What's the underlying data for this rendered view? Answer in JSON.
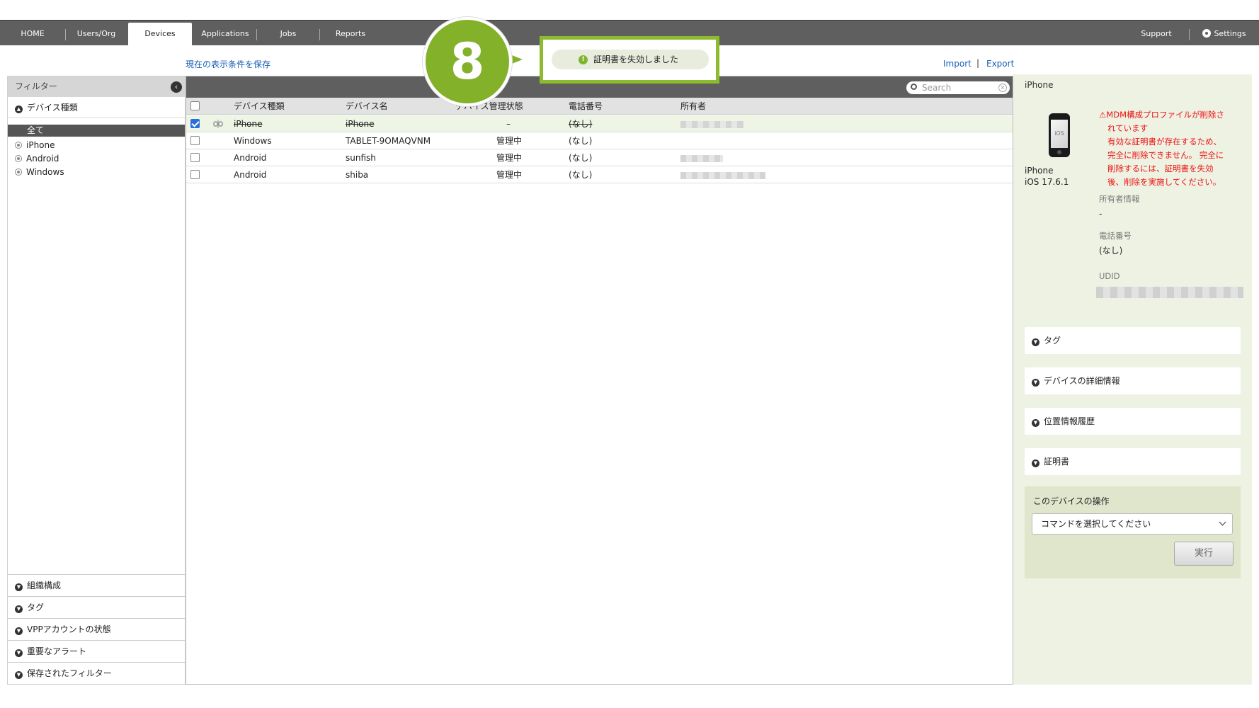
{
  "nav": {
    "tabs": [
      {
        "label": "HOME"
      },
      {
        "label": "Users/Org"
      },
      {
        "label": "Devices"
      },
      {
        "label": "Applications"
      },
      {
        "label": "Jobs"
      },
      {
        "label": "Reports"
      }
    ],
    "support": "Support",
    "settings": "Settings"
  },
  "toolbar": {
    "save_view": "現在の表示条件を保存",
    "import": "Import",
    "separator": "|",
    "export": "Export"
  },
  "toast": {
    "message": "証明書を失効しました",
    "callout_number": "8"
  },
  "filter": {
    "title": "フィルター",
    "device_type_header": "デバイス種類",
    "options": [
      "全て",
      "iPhone",
      "Android",
      "Windows"
    ],
    "selected": "全て",
    "sections": [
      "組織構成",
      "タグ",
      "VPPアカウントの状態",
      "重要なアラート",
      "保存されたフィルター"
    ]
  },
  "table": {
    "search_placeholder": "Search",
    "columns": [
      "デバイス種類",
      "デバイス名",
      "デバイス管理状態",
      "電話番号",
      "所有者"
    ],
    "rows": [
      {
        "type": "iPhone",
        "name": "iPhone",
        "status": "–",
        "phone": "(なし)",
        "checked": true,
        "struck": true
      },
      {
        "type": "Windows",
        "name": "TABLET-9OMAQVNM",
        "status": "管理中",
        "phone": "(なし)",
        "checked": false,
        "struck": false
      },
      {
        "type": "Android",
        "name": "sunfish",
        "status": "管理中",
        "phone": "(なし)",
        "checked": false,
        "struck": false
      },
      {
        "type": "Android",
        "name": "shiba",
        "status": "管理中",
        "phone": "(なし)",
        "checked": false,
        "struck": false
      }
    ]
  },
  "detail": {
    "title": "iPhone",
    "icon_text": "iOS",
    "model": "iPhone",
    "os": "iOS 17.6.1",
    "warning_lines": [
      "⚠MDM構成プロファイルが削除さ",
      "れています",
      "有効な証明書が存在するため、",
      "完全に削除できません。 完全に",
      "削除するには、証明書を失効",
      "後、削除を実施してください。"
    ],
    "owner_label": "所有者情報",
    "owner_value": "-",
    "phone_label": "電話番号",
    "phone_value": "(なし)",
    "udid_label": "UDID",
    "accordions": [
      "タグ",
      "デバイスの詳細情報",
      "位置情報履歴",
      "証明書"
    ],
    "ops_title": "このデバイスの操作",
    "command_placeholder": "コマンドを選択してください",
    "run_button": "実行"
  },
  "colors": {
    "nav_bg": "#5f5f5f",
    "accent_green": "#83b22a",
    "warning_red": "#e11111",
    "link_blue": "#1a5fb4"
  }
}
